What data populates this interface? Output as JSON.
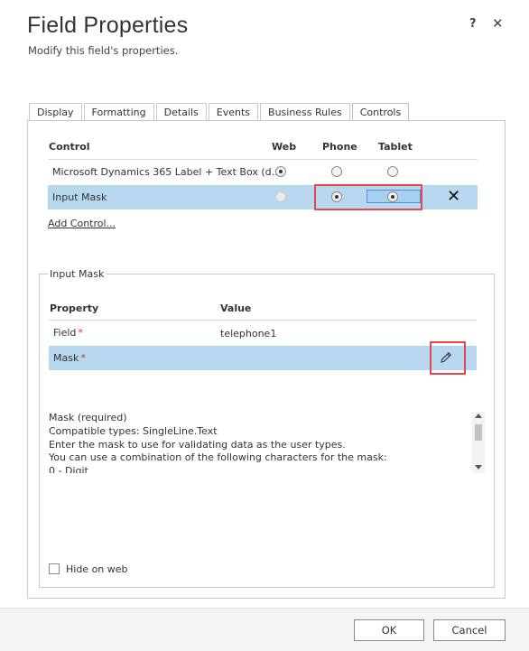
{
  "dialog": {
    "title": "Field Properties",
    "subtitle": "Modify this field's properties.",
    "help_label": "?",
    "close_label": "✕"
  },
  "tabs": [
    {
      "label": "Display"
    },
    {
      "label": "Formatting"
    },
    {
      "label": "Details"
    },
    {
      "label": "Events"
    },
    {
      "label": "Business Rules"
    },
    {
      "label": "Controls",
      "active": true
    }
  ],
  "controls": {
    "headers": {
      "control": "Control",
      "web": "Web",
      "phone": "Phone",
      "tablet": "Tablet"
    },
    "rows": [
      {
        "name": "Microsoft Dynamics 365 Label + Text Box (d...",
        "web": true,
        "phone": false,
        "tablet": false,
        "selected": false
      },
      {
        "name": "Input Mask",
        "web": false,
        "phone": true,
        "tablet": true,
        "selected": true,
        "web_disabled": true
      }
    ],
    "remove_label": "✕",
    "add_control_label": "Add Control..."
  },
  "input_mask": {
    "legend": "Input Mask",
    "headers": {
      "property": "Property",
      "value": "Value"
    },
    "rows": [
      {
        "property": "Field",
        "required_mark": "*",
        "value": "telephone1",
        "selected": false
      },
      {
        "property": "Mask",
        "required_mark": "*",
        "value": "",
        "selected": true
      }
    ],
    "edit_icon": "pencil-icon",
    "description": [
      "Mask (required)",
      "Compatible types: SingleLine.Text",
      "Enter the mask to use for validating data as the user types.",
      "You can use a combination of the following characters for the mask:",
      "0 - Digit"
    ],
    "hide_on_web_label": "Hide on web",
    "hide_on_web_checked": false
  },
  "footer": {
    "ok_label": "OK",
    "cancel_label": "Cancel"
  },
  "colors": {
    "selection": "#b7d7ee",
    "highlight": "#e0484d",
    "required": "#d13438"
  }
}
